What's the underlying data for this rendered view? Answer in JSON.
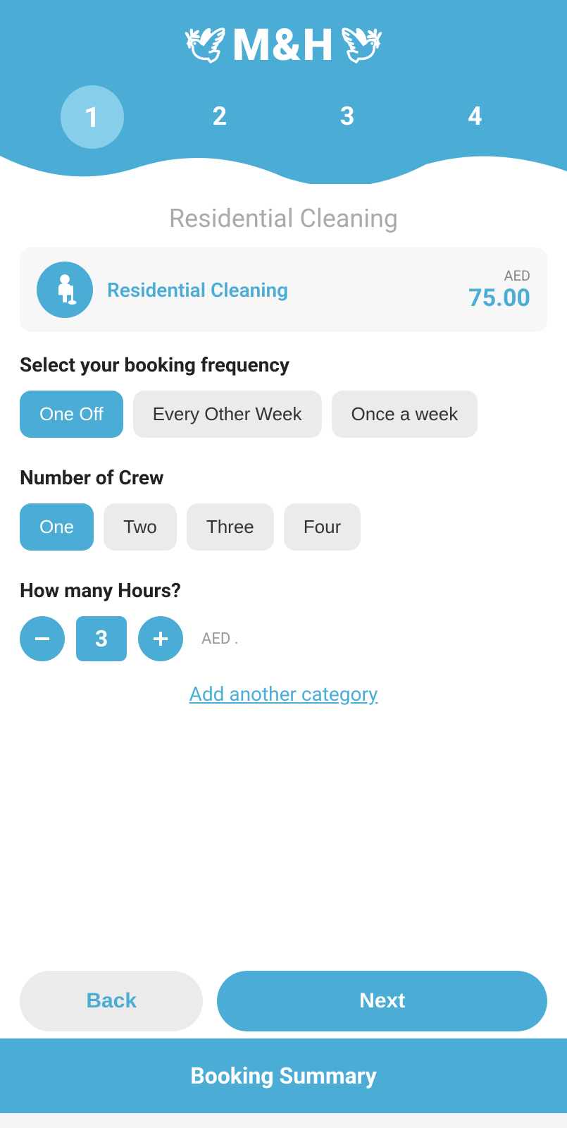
{
  "header": {
    "logo": "M&H",
    "logo_wing_left": "🕊",
    "logo_wing_right": "🕊"
  },
  "steps": [
    {
      "number": "1",
      "active": true
    },
    {
      "number": "2",
      "active": false
    },
    {
      "number": "3",
      "active": false
    },
    {
      "number": "4",
      "active": false
    }
  ],
  "page_title": "Residential Cleaning",
  "service_card": {
    "name": "Residential Cleaning",
    "currency": "AED",
    "price": "75.00"
  },
  "booking_frequency": {
    "section_title": "Select your booking frequency",
    "options": [
      {
        "label": "One Off",
        "selected": true
      },
      {
        "label": "Every Other Week",
        "selected": false
      },
      {
        "label": "Once a week",
        "selected": false
      }
    ]
  },
  "crew": {
    "section_title": "Number of Crew",
    "options": [
      {
        "label": "One",
        "selected": true
      },
      {
        "label": "Two",
        "selected": false
      },
      {
        "label": "Three",
        "selected": false
      },
      {
        "label": "Four",
        "selected": false
      }
    ]
  },
  "hours": {
    "section_title": "How many Hours?",
    "value": "3",
    "currency": "AED",
    "price": "."
  },
  "add_category_label": "Add another category",
  "buttons": {
    "back": "Back",
    "next": "Next"
  },
  "booking_summary": "Booking Summary"
}
